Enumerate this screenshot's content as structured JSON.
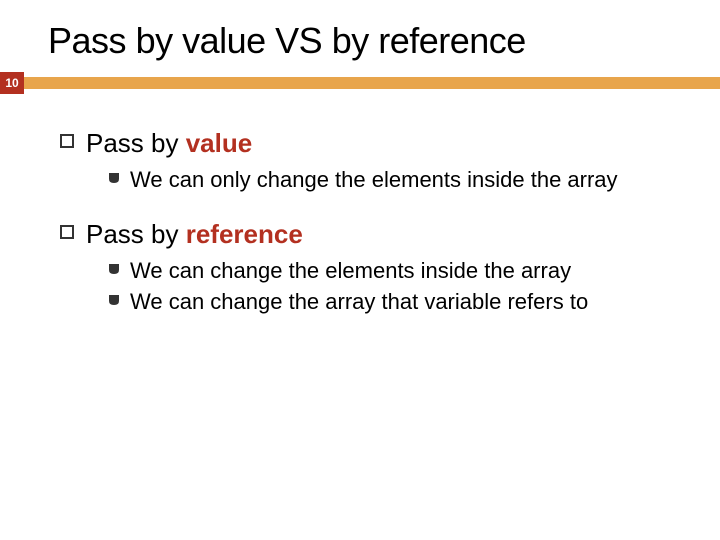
{
  "page_number": "10",
  "title": {
    "part1": "Pass",
    "part2": " by value ",
    "part3": "VS",
    "part4": " by reference"
  },
  "sections": [
    {
      "heading_plain": "Pass by ",
      "heading_accent": "value",
      "subs": [
        "We can only change the elements inside the array"
      ]
    },
    {
      "heading_plain": "Pass by ",
      "heading_accent": "reference",
      "subs": [
        "We can change the elements inside the array",
        "We can change the array that variable refers to"
      ]
    }
  ],
  "colors": {
    "accent_red": "#b33020",
    "bar_orange": "#e8a54c"
  }
}
